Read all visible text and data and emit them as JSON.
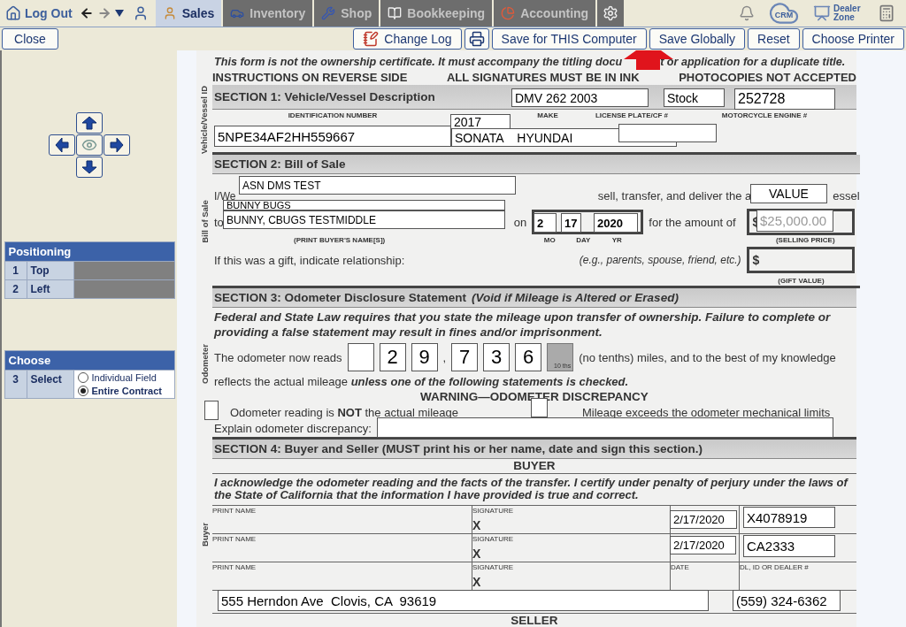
{
  "top_nav": {
    "logout": "Log Out",
    "tabs": [
      {
        "label": "Sales",
        "kind": "person",
        "selected": true
      },
      {
        "label": "Inventory",
        "kind": "car",
        "selected": false
      },
      {
        "label": "Shop",
        "kind": "wrench",
        "selected": false
      },
      {
        "label": "Bookkeeping",
        "kind": "book",
        "selected": false
      },
      {
        "label": "Accounting",
        "kind": "pie",
        "selected": false
      }
    ],
    "crm": "CRM",
    "dealer_zone": "Dealer Zone"
  },
  "action_bar": {
    "close": "Close",
    "buttons": [
      {
        "kind": "log",
        "label": "Change Log"
      },
      {
        "kind": "print"
      },
      {
        "kind": "text",
        "label": "Save for THIS Computer"
      },
      {
        "kind": "text",
        "label": "Save Globally"
      },
      {
        "kind": "text",
        "label": "Reset"
      },
      {
        "kind": "text",
        "label": "Choose Printer"
      }
    ]
  },
  "left_panel": {
    "positioning": {
      "title": "Positioning",
      "rows": [
        {
          "number": "1",
          "label": "Top"
        },
        {
          "number": "2",
          "label": "Left"
        }
      ]
    },
    "choose": {
      "title": "Choose",
      "number": "3",
      "label": "Select",
      "options": [
        {
          "label": "Individual Field",
          "selected": false
        },
        {
          "label": "Entire Contract",
          "selected": true
        }
      ]
    }
  },
  "form": {
    "notice": [
      "This form is not the ownership certificate. It must accompany the titling docu",
      "t or application for a duplicate title."
    ],
    "instructions": [
      "INSTRUCTIONS ON REVERSE SIDE",
      "ALL SIGNATURES MUST BE IN INK",
      "PHOTOCOPIES NOT ACCEPTED"
    ],
    "section1": {
      "side_label": "Vehicle/Vessel ID",
      "title": "SECTION 1:  Vehicle/Vessel Description",
      "columns": [
        "IDENTIFICATION NUMBER",
        "MAKE",
        "LICENSE PLATE/CF #",
        "MOTORCYCLE ENGINE #"
      ]
    },
    "section2": {
      "side_label": "Bill of Sale",
      "title": "SECTION 2:  Bill of Sale",
      "seller_prefix": "I/We",
      "transfer_text": "sell, transfer, and deliver the a",
      "transfer_tail": "essel",
      "buyer_prefix": "to",
      "date_prefix": "on",
      "amount_text": "for  the amount of",
      "currency": "$",
      "buyer_caption": "(PRINT BUYER'S NAME[S])",
      "date_captions": [
        "MO",
        "DAY",
        "YR"
      ],
      "price_caption": "(SELLING PRICE)",
      "gift_text": "If this was a gift, indicate relationship:",
      "gift_hint": "(e.g., parents, spouse, friend, etc.)",
      "gift_currency": "$",
      "gift_caption": "(GIFT VALUE)"
    },
    "section3": {
      "side_label": "Odometer",
      "title": "SECTION 3:  Odometer Disclosure Statement",
      "title_note": "(Void if Mileage is Altered or Erased)",
      "warning_text": "Federal and State Law requires that you state the mileage upon transfer of ownership. Failure to complete or providing a false statement may result in fines and/or imprisonment.",
      "reads_text": "The odometer now reads",
      "digits": [
        {
          "kind": "blank"
        },
        {
          "kind": "digit",
          "value": "2"
        },
        {
          "kind": "digit",
          "value": "9"
        },
        {
          "kind": "separator",
          "value": ","
        },
        {
          "kind": "digit",
          "value": "7"
        },
        {
          "kind": "digit",
          "value": "3"
        },
        {
          "kind": "digit",
          "value": "6"
        },
        {
          "kind": "tenths",
          "value": "10 ths"
        }
      ],
      "reads_tail": "(no tenths) miles, and to the best of my knowledge",
      "reflects_text": "reflects the actual mileage **unless one of the following statements is checked.**",
      "discrepancy_title": "WARNING—ODOMETER DISCREPANCY",
      "statements": [
        "Odometer reading is **NOT** the actual mileage",
        "Mileage exceeds the odometer mechanical limits"
      ],
      "explain_label": "Explain odometer discrepancy:"
    },
    "section4": {
      "side_label": "Buyer",
      "title": "SECTION 4:  Buyer and Seller (MUST print his or her name, date and sign this section.)",
      "party": "BUYER",
      "certification": "I acknowledge the odometer reading and the facts of the transfer. I certify under penalty of perjury under the laws of the State of California that the information I have provided is true and correct.",
      "rows": [
        {
          "name_label": "PRINT NAME",
          "signature_label": "SIGNATURE",
          "mark": "X"
        },
        {
          "name_label": "PRINT NAME",
          "signature_label": "SIGNATURE",
          "mark": "X"
        },
        {
          "name_label": "PRINT NAME",
          "signature_label": "SIGNATURE",
          "mark": "X",
          "date_label": "DATE",
          "id_label": "DL, ID OR DEALER #"
        }
      ],
      "next_party": "SELLER"
    }
  },
  "overlay_fields": [
    {
      "kind": "text",
      "value": "DMV 262 2003"
    },
    {
      "kind": "text",
      "value": "Stock"
    },
    {
      "kind": "text",
      "value": "252728"
    },
    {
      "kind": "text",
      "value": "2017"
    },
    {
      "kind": "text",
      "value": "5NPE34AF2HH559667"
    },
    {
      "kind": "text",
      "value": "SONATA    HYUNDAI"
    },
    {
      "kind": "text"
    },
    {
      "kind": "text",
      "value": "ASN DMS TEST"
    },
    {
      "kind": "text",
      "value": "BUNNY BUGS"
    },
    {
      "kind": "text",
      "value": "BUNNY, CBUGS TESTMIDDLE"
    },
    {
      "kind": "text",
      "value": "VALUE"
    },
    {
      "kind": "text",
      "value": "2"
    },
    {
      "kind": "text",
      "value": "17"
    },
    {
      "kind": "text",
      "value": "2020"
    },
    {
      "kind": "text",
      "placeholder": "$25,000.00"
    },
    {
      "kind": "checkbox",
      "checked": false
    },
    {
      "kind": "checkbox",
      "checked": false
    },
    {
      "kind": "text"
    },
    {
      "kind": "text",
      "value": "2/17/2020"
    },
    {
      "kind": "text",
      "value": "X4078919"
    },
    {
      "kind": "text",
      "value": "2/17/2020"
    },
    {
      "kind": "text",
      "value": "CA2333"
    },
    {
      "kind": "text",
      "value": "555 Herndon Ave  Clovis, CA  93619"
    },
    {
      "kind": "text",
      "value": "(559) 324-6362"
    }
  ]
}
